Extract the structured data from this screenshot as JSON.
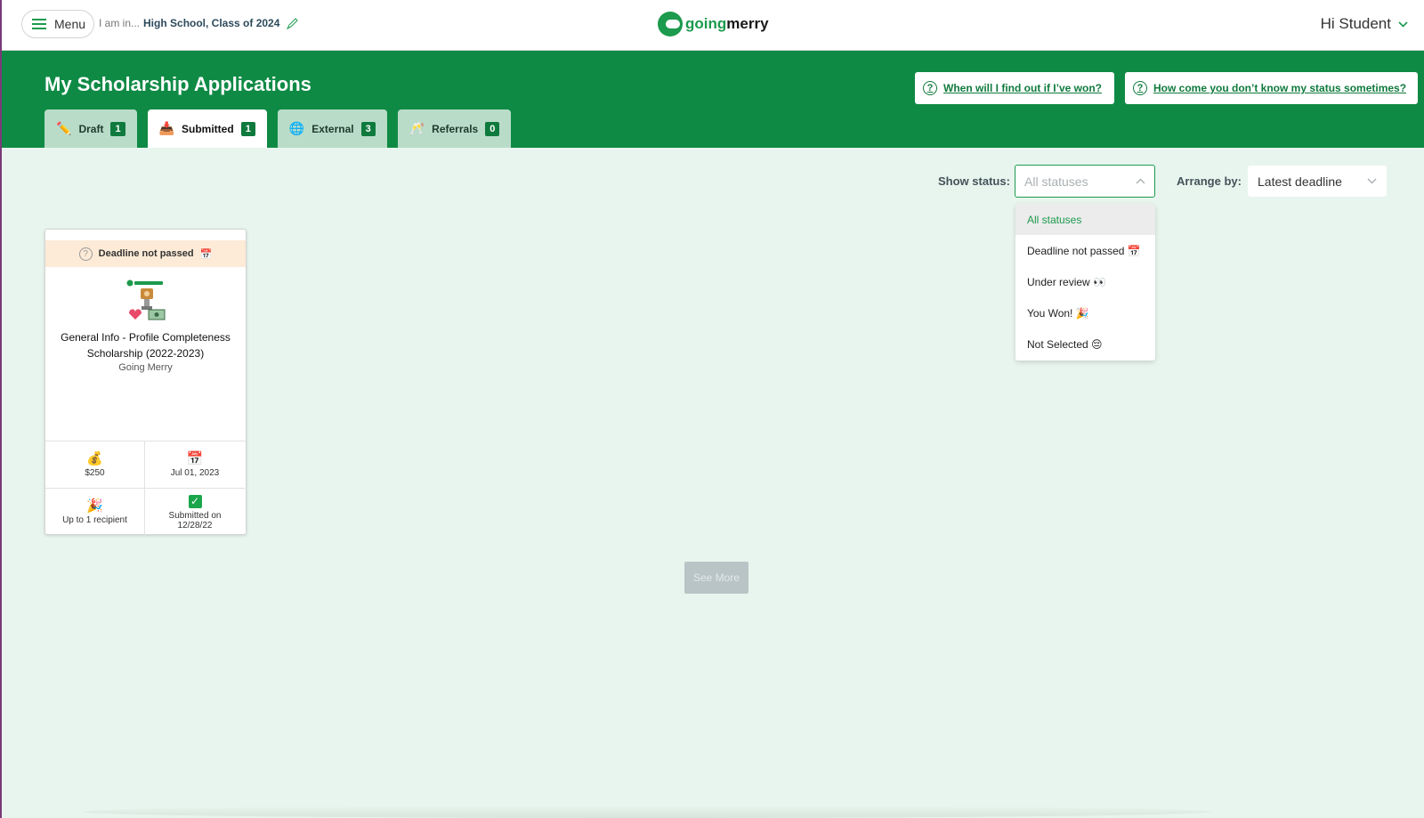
{
  "topbar": {
    "menu_label": "Menu",
    "iam_prefix": "I am in...",
    "iam_value": "High School, Class of 2024",
    "logo_going": "going",
    "logo_merry": "merry",
    "greeting": "Hi Student"
  },
  "header": {
    "title": "My Scholarship Applications",
    "help_won": "When will I find out if I’ve won?",
    "help_status": "How come you don’t know my status sometimes?",
    "tabs": [
      {
        "label": "Draft",
        "count": "1",
        "icon": "✏️"
      },
      {
        "label": "Submitted",
        "count": "1",
        "icon": "📥"
      },
      {
        "label": "External",
        "count": "3",
        "icon": "🌐"
      },
      {
        "label": "Referrals",
        "count": "0",
        "icon": "🥂"
      }
    ]
  },
  "filters": {
    "show_status_label": "Show status:",
    "status_placeholder": "All statuses",
    "arrange_label": "Arrange by:",
    "arrange_value": "Latest deadline",
    "status_options": [
      "All statuses",
      "Deadline not passed 📅",
      "Under review 👀",
      "You Won! 🎉",
      "Not Selected 😔"
    ]
  },
  "card": {
    "status": "Deadline not passed",
    "status_icon": "📅",
    "title": "General Info - Profile Completeness Scholarship (2022-2023)",
    "org": "Going Merry",
    "amount": "$250",
    "amount_icon": "💰",
    "deadline": "Jul 01, 2023",
    "deadline_icon": "📅",
    "recipients": "Up to 1 recipient",
    "recipients_icon": "🎉",
    "submitted_line1": "Submitted on",
    "submitted_line2": "12/28/22"
  },
  "see_more": "See More",
  "colors": {
    "brand_green": "#0f8a45",
    "page_bg": "#e8f5ee"
  }
}
